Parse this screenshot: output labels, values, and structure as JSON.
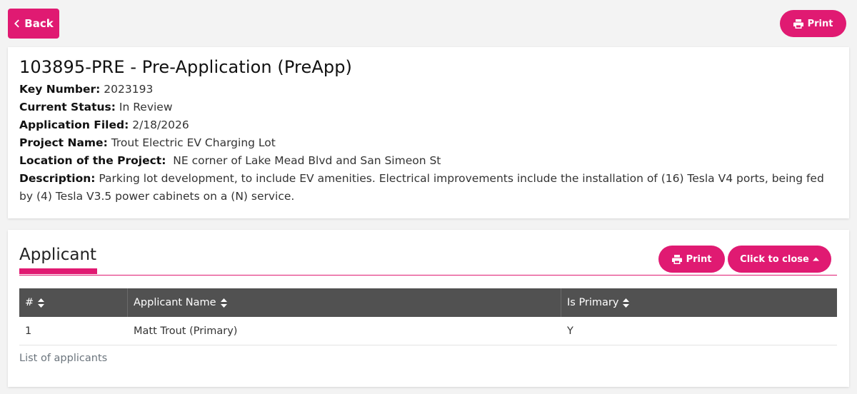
{
  "nav": {
    "back_label": "Back",
    "print_label": "Print"
  },
  "record": {
    "title": "103895-PRE - Pre-Application (PreApp)",
    "key_number_label": "Key Number:",
    "key_number": "2023193",
    "status_label": "Current Status:",
    "status": "In Review",
    "filed_label": "Application Filed:",
    "filed": "2/18/2026",
    "project_name_label": "Project Name:",
    "project_name": "Trout Electric EV Charging Lot",
    "location_label": "Location of the Project:",
    "location": "NE corner of Lake Mead Blvd and San Simeon St",
    "description_label": "Description:",
    "description": "Parking lot development, to include EV amenities. Electrical improvements include the installation of (16) Tesla V4 ports, being fed by (4) Tesla V3.5 power cabinets on a (N) service."
  },
  "applicant": {
    "heading": "Applicant",
    "print_label": "Print",
    "close_label": "Click to close",
    "columns": [
      "#",
      "Applicant Name",
      "Is Primary"
    ],
    "rows": [
      {
        "num": "1",
        "name": "Matt Trout (Primary)",
        "primary": "Y"
      }
    ],
    "caption": "List of applicants"
  },
  "icons": {
    "back": "chevron-left-icon",
    "print": "printer-icon",
    "close": "caret-up-icon",
    "sort": "sort-icon"
  },
  "colors": {
    "accent": "#e01a72",
    "table_header": "#515151"
  }
}
